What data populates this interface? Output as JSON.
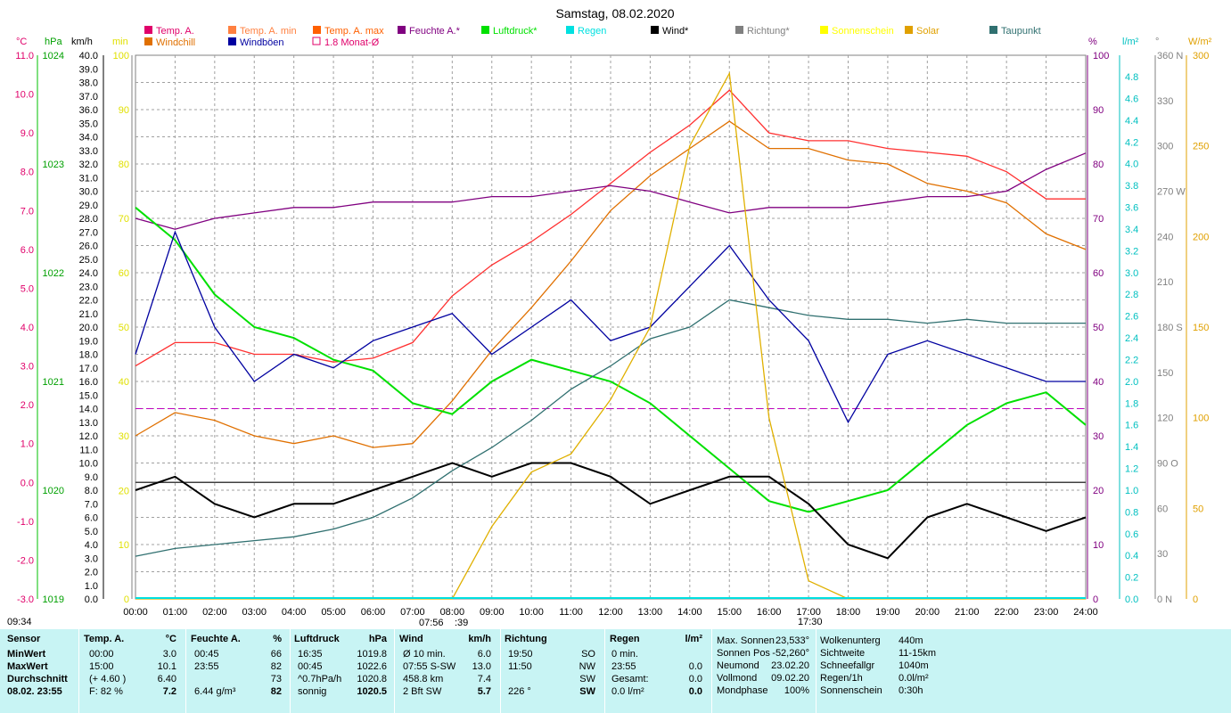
{
  "title": "Samstag, 08.02.2020",
  "legend": [
    {
      "label": "Temp. A.",
      "color": "#e0006a"
    },
    {
      "label": "Temp. A. min",
      "color": "#ff8040"
    },
    {
      "label": "Temp. A. max",
      "color": "#ff6000"
    },
    {
      "label": "Feuchte A.*",
      "color": "#800080"
    },
    {
      "label": "Luftdruck*",
      "color": "#00e000"
    },
    {
      "label": "Regen",
      "color": "#00e0e0"
    },
    {
      "label": "Wind*",
      "color": "#000000"
    },
    {
      "label": "Richtung*",
      "color": "#808080"
    },
    {
      "label": "Sonnenschein",
      "color": "#ffff00"
    },
    {
      "label": "Solar",
      "color": "#e0a000"
    },
    {
      "label": "Taupunkt",
      "color": "#307070"
    },
    {
      "label": "Windchill",
      "color": "#e07000"
    },
    {
      "label": "Windböen",
      "color": "#0000a0"
    },
    {
      "label": "1.8 Monat-Ø",
      "color": "#e0006a"
    }
  ],
  "axis_units": {
    "temp": "°C",
    "hpa": "hPa",
    "kmh": "km/h",
    "min": "min",
    "pct": "%",
    "rain": "l/m²",
    "deg": "°",
    "wm2": "W/m²"
  },
  "axis_ticks": {
    "temp": [
      "11.0",
      "10.0",
      "9.0",
      "8.0",
      "7.0",
      "6.0",
      "5.0",
      "4.0",
      "3.0",
      "2.0",
      "1.0",
      "0.0",
      "-1.0",
      "-2.0",
      "-3.0"
    ],
    "hpa": [
      "1024",
      "1023",
      "1022",
      "1021",
      "1020",
      "1019"
    ],
    "kmh": [
      "40.0",
      "39.0",
      "38.0",
      "37.0",
      "36.0",
      "35.0",
      "34.0",
      "33.0",
      "32.0",
      "31.0",
      "30.0",
      "29.0",
      "28.0",
      "27.0",
      "26.0",
      "25.0",
      "24.0",
      "23.0",
      "22.0",
      "21.0",
      "20.0",
      "19.0",
      "18.0",
      "17.0",
      "16.0",
      "15.0",
      "14.0",
      "13.0",
      "12.0",
      "11.0",
      "10.0",
      "9.0",
      "8.0",
      "7.0",
      "6.0",
      "5.0",
      "4.0",
      "3.0",
      "2.0",
      "1.0",
      "0.0"
    ],
    "min_upper": [
      "100",
      "90",
      "80",
      "70",
      "60",
      "50",
      "40",
      "30"
    ],
    "min_lower": [
      "20",
      "10",
      "0"
    ],
    "pct": [
      "100",
      "90",
      "80",
      "70",
      "60",
      "50",
      "40",
      "30",
      "20",
      "10",
      "0"
    ],
    "rain": [
      "4.8",
      "4.6",
      "4.4",
      "4.2",
      "4.0",
      "3.8",
      "3.6",
      "3.4",
      "3.2",
      "3.0",
      "2.8",
      "2.6",
      "2.4",
      "2.2",
      "2.0",
      "1.8",
      "1.6",
      "1.4",
      "1.2",
      "1.0",
      "0.8",
      "0.6",
      "0.4",
      "0.2",
      "0.0"
    ],
    "deg": [
      "360 N",
      "330",
      "300",
      "270 W",
      "240",
      "210",
      "180 S",
      "150",
      "120",
      "90  O",
      "60",
      "30",
      "0   N"
    ],
    "wm2": [
      "300",
      "250",
      "200",
      "150",
      "100",
      "50",
      "0"
    ],
    "x": [
      "00:00",
      "01:00",
      "02:00",
      "03:00",
      "04:00",
      "05:00",
      "06:00",
      "07:00",
      "08:00",
      "09:00",
      "10:00",
      "11:00",
      "12:00",
      "13:00",
      "14:00",
      "15:00",
      "16:00",
      "17:00",
      "18:00",
      "19:00",
      "20:00",
      "21:00",
      "22:00",
      "23:00",
      "24:00"
    ]
  },
  "bottom_labels": {
    "left": "09:34",
    "sunrise": "07:56",
    "sunrise2": ":39",
    "sunset": "17:30"
  },
  "chart_data": {
    "type": "line",
    "title": "Samstag, 08.02.2020",
    "x": [
      "00:00",
      "01:00",
      "02:00",
      "03:00",
      "04:00",
      "05:00",
      "06:00",
      "07:00",
      "08:00",
      "09:00",
      "10:00",
      "11:00",
      "12:00",
      "13:00",
      "14:00",
      "15:00",
      "16:00",
      "17:00",
      "18:00",
      "19:00",
      "20:00",
      "21:00",
      "22:00",
      "23:00",
      "24:00"
    ],
    "series": [
      {
        "name": "Temp. A.",
        "unit": "°C",
        "values": [
          3.0,
          3.6,
          3.6,
          3.3,
          3.3,
          3.1,
          3.2,
          3.6,
          4.8,
          5.6,
          6.2,
          6.9,
          7.7,
          8.5,
          9.2,
          10.1,
          9.0,
          8.8,
          8.8,
          8.6,
          8.5,
          8.4,
          8.0,
          7.3,
          7.3
        ]
      },
      {
        "name": "Windchill",
        "unit": "°C",
        "values": [
          1.2,
          1.8,
          1.6,
          1.2,
          1.0,
          1.2,
          0.9,
          1.0,
          2.1,
          3.4,
          4.5,
          5.7,
          7.0,
          7.9,
          8.6,
          9.3,
          8.6,
          8.6,
          8.3,
          8.2,
          7.7,
          7.5,
          7.2,
          6.4,
          6.0
        ]
      },
      {
        "name": "Feuchte A.*",
        "unit": "%",
        "values": [
          70,
          68,
          70,
          71,
          72,
          72,
          73,
          73,
          73,
          74,
          74,
          75,
          76,
          75,
          73,
          71,
          72,
          72,
          72,
          73,
          74,
          74,
          75,
          79,
          82
        ]
      },
      {
        "name": "Luftdruck*",
        "unit": "hPa",
        "values": [
          1022.6,
          1022.3,
          1021.8,
          1021.5,
          1021.4,
          1021.2,
          1021.1,
          1020.8,
          1020.7,
          1021.0,
          1021.2,
          1021.1,
          1021.0,
          1020.8,
          1020.5,
          1020.2,
          1019.9,
          1019.8,
          1019.9,
          1020.0,
          1020.3,
          1020.6,
          1020.8,
          1020.9,
          1020.6
        ]
      },
      {
        "name": "Taupunkt",
        "unit": "°C",
        "values": [
          -1.9,
          -1.7,
          -1.6,
          -1.5,
          -1.4,
          -1.2,
          -0.9,
          -0.4,
          0.3,
          0.9,
          1.6,
          2.4,
          3.0,
          3.7,
          4.0,
          4.7,
          4.5,
          4.3,
          4.2,
          4.2,
          4.1,
          4.2,
          4.1,
          4.1,
          4.1
        ]
      },
      {
        "name": "Wind*",
        "unit": "km/h",
        "values": [
          8.0,
          9.0,
          7.0,
          6.0,
          7.0,
          7.0,
          8.0,
          9.0,
          10.0,
          9.0,
          10.0,
          10.0,
          9.0,
          7.0,
          8.0,
          9.0,
          9.0,
          7.0,
          4.0,
          3.0,
          6.0,
          7.0,
          6.0,
          5.0,
          6.0
        ]
      },
      {
        "name": "Windböen",
        "unit": "km/h",
        "values": [
          18.0,
          27.0,
          20.0,
          16.0,
          18.0,
          17.0,
          19.0,
          20.0,
          21.0,
          18.0,
          20.0,
          22.0,
          19.0,
          20.0,
          23.0,
          26.0,
          22.0,
          19.0,
          13.0,
          18.0,
          19.0,
          18.0,
          17.0,
          16.0,
          16.0
        ]
      },
      {
        "name": "Solar",
        "unit": "W/m²",
        "values": [
          0,
          0,
          0,
          0,
          0,
          0,
          0,
          0,
          0,
          40,
          70,
          80,
          110,
          150,
          250,
          290,
          100,
          10,
          0,
          0,
          0,
          0,
          0,
          0,
          0
        ]
      }
    ],
    "ylim_temp": [
      -3.0,
      11.0
    ]
  },
  "stats": {
    "headers": {
      "sensor": "Sensor",
      "temp": "Temp. A.",
      "temp_unit": "°C",
      "hum": "Feuchte A.",
      "hum_unit": "%",
      "press": "Luftdruck",
      "press_unit": "hPa",
      "wind": "Wind",
      "wind_unit": "km/h",
      "dir": "Richtung",
      "rain": "Regen",
      "rain_unit": "l/m²"
    },
    "row_labels": [
      "MinWert",
      "MaxWert",
      "Durchschnitt",
      "08.02. 23:55"
    ],
    "temp": [
      [
        "00:00",
        "3.0"
      ],
      [
        "15:00",
        "10.1"
      ],
      [
        "(+ 4.60 )",
        "6.40"
      ],
      [
        "F: 82 %",
        "7.2"
      ]
    ],
    "hum": [
      [
        "00:45",
        "66"
      ],
      [
        "23:55",
        "82"
      ],
      [
        "",
        "73"
      ],
      [
        "6.44 g/m³",
        "82"
      ]
    ],
    "press": [
      [
        "16:35",
        "1019.8"
      ],
      [
        "00:45",
        "1022.6"
      ],
      [
        "^0.7hPa/h",
        "1020.8"
      ],
      [
        "sonnig",
        "1020.5"
      ]
    ],
    "wind": [
      [
        "Ø 10 min.",
        "6.0"
      ],
      [
        "07:55  S-SW",
        "13.0"
      ],
      [
        "458.8 km",
        "7.4"
      ],
      [
        "2 Bft SW",
        "5.7"
      ]
    ],
    "dir": [
      [
        "19:50",
        "SO"
      ],
      [
        "11:50",
        "NW"
      ],
      [
        "",
        "SW"
      ],
      [
        "226 °",
        "SW"
      ]
    ],
    "rain": [
      [
        "0 min.",
        ""
      ],
      [
        "23:55",
        "0.0"
      ],
      [
        "Gesamt:",
        "0.0"
      ],
      [
        "0.0 l/m²",
        "0.0"
      ]
    ],
    "astro": [
      [
        "Max. Sonnen",
        "23,533°"
      ],
      [
        "Sonnen Pos",
        "-52,260°"
      ],
      [
        "Neumond",
        "23.02.20"
      ],
      [
        "Vollmond",
        "09.02.20"
      ],
      [
        "Mondphase",
        "100%"
      ]
    ],
    "misc": [
      [
        "Wolkenunterg",
        "440m"
      ],
      [
        "Sichtweite",
        "11-15km"
      ],
      [
        "Schneefallgr",
        "1040m"
      ],
      [
        "Regen/1h",
        "0.0l/m²"
      ],
      [
        "Sonnenschein",
        "0:30h"
      ]
    ]
  }
}
